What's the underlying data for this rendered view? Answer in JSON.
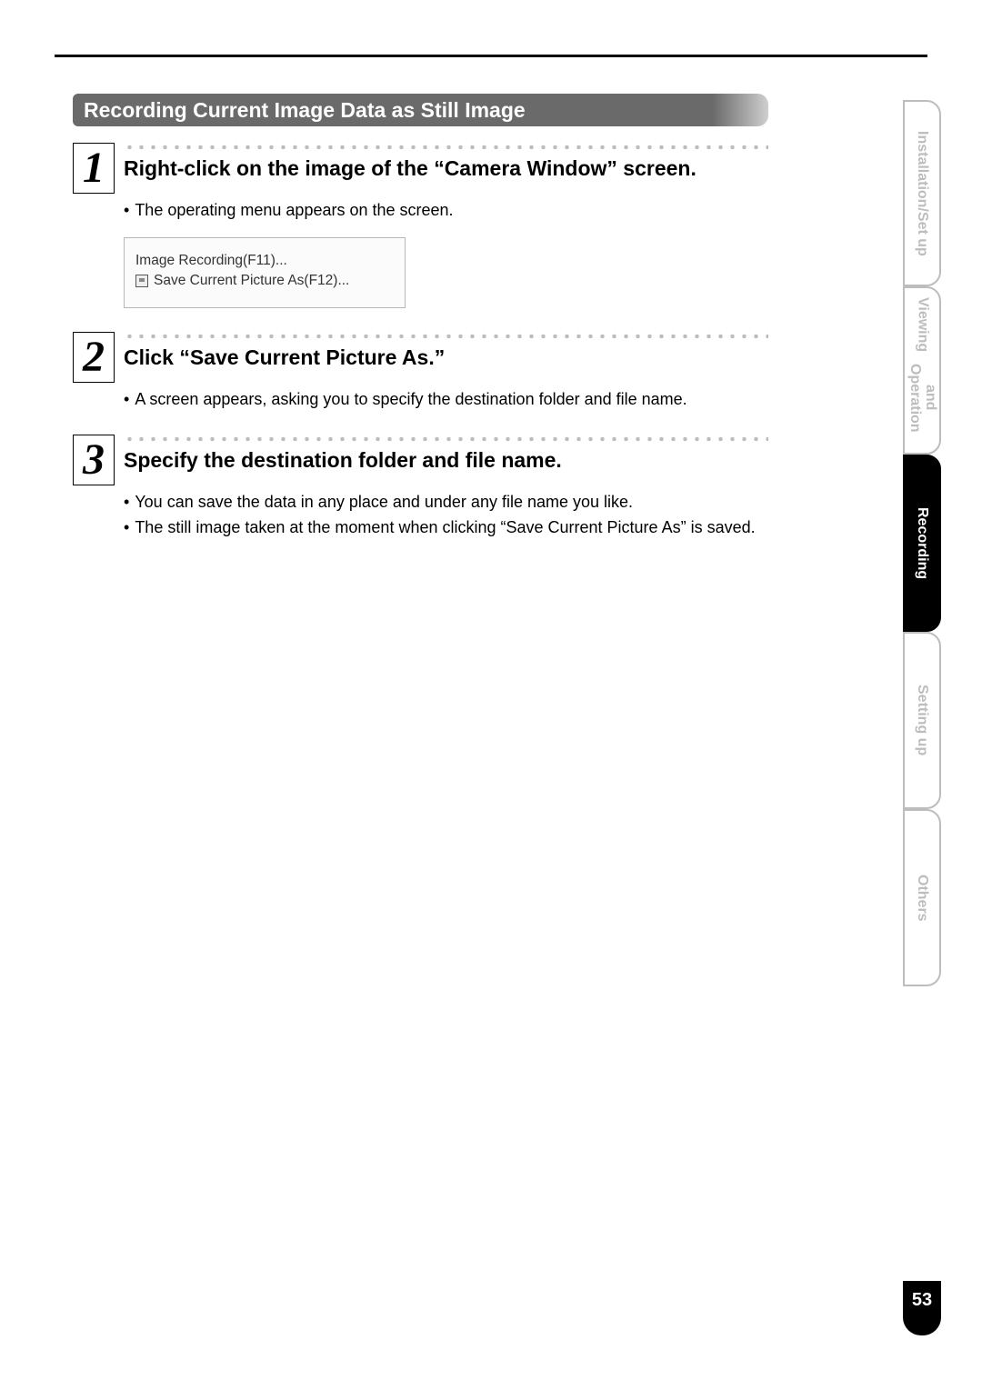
{
  "section_title": "Recording Current Image Data as Still Image",
  "steps": [
    {
      "num": "1",
      "title": "Right-click on the image of the “Camera Window” screen.",
      "bullets": [
        "The operating menu appears on the screen."
      ],
      "menu": {
        "item1": "Image Recording(F11)...",
        "item2": "Save Current Picture As(F12)..."
      }
    },
    {
      "num": "2",
      "title": "Click “Save Current Picture As.”",
      "bullets": [
        "A screen appears, asking you to specify the destination folder and file name."
      ]
    },
    {
      "num": "3",
      "title": "Specify the destination folder and file name.",
      "bullets": [
        "You can save the data in any place and under any file name you like.",
        "The still image taken at the moment when clicking “Save Current Picture As” is saved."
      ]
    }
  ],
  "tabs": {
    "t1": "Installation/Set up",
    "t2_line1": "Viewing",
    "t2_line2": "and Operation",
    "t3": "Recording",
    "t4": "Setting up",
    "t5": "Others"
  },
  "page_number": "53"
}
